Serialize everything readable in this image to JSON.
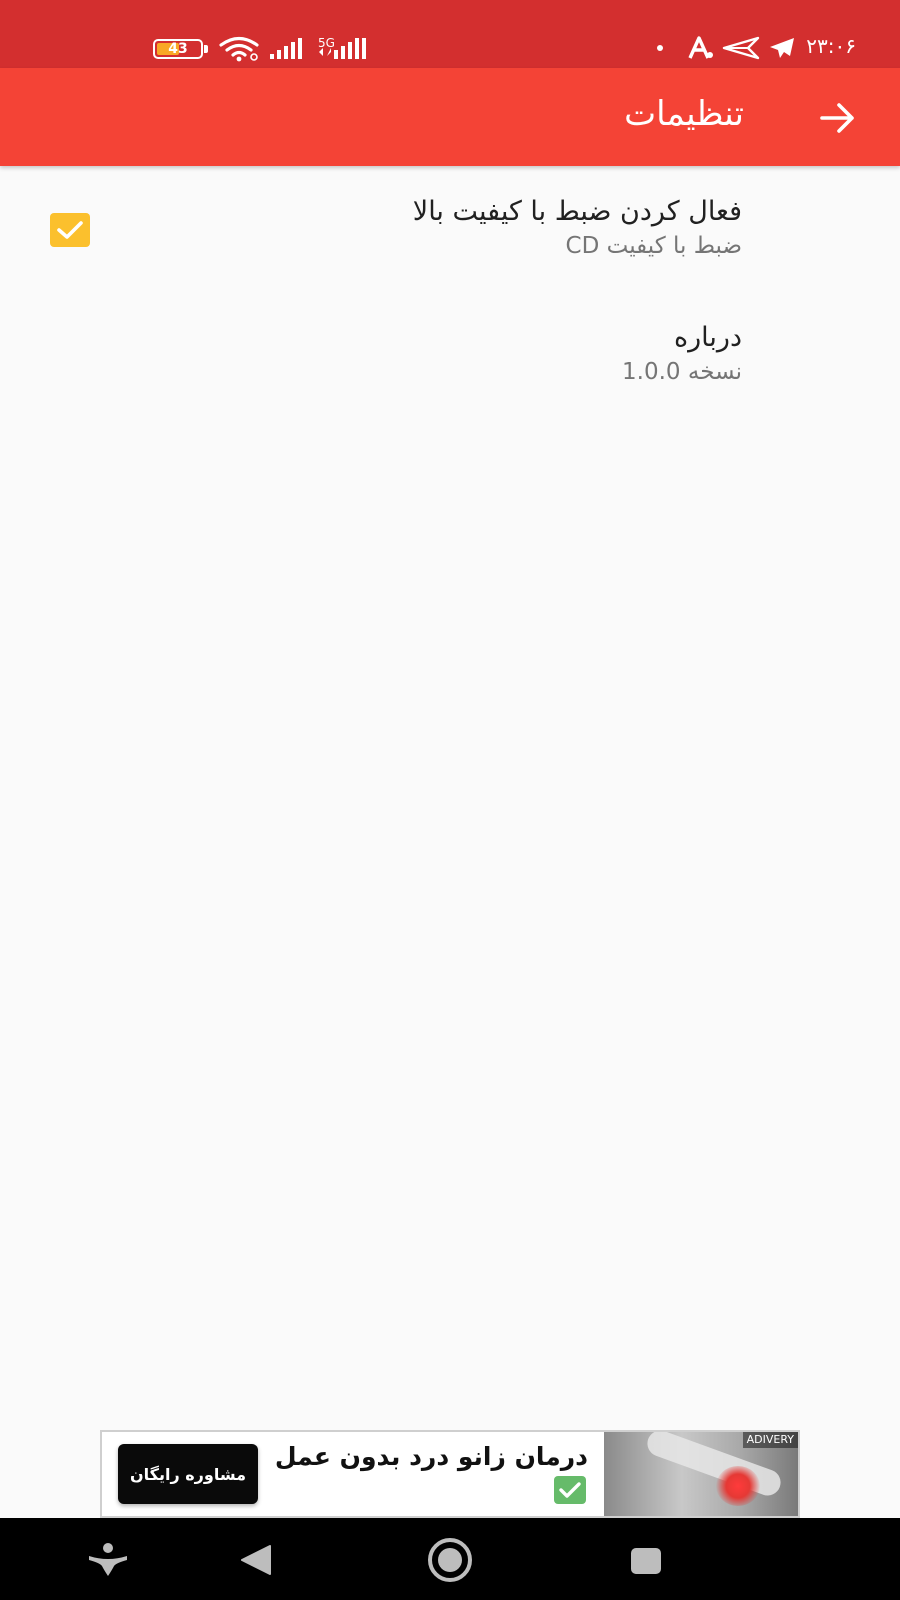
{
  "status_bar": {
    "time": "۲۳:۰۶",
    "battery_level": "43",
    "network_type": "5G",
    "icons": [
      "battery-icon",
      "wifi-icon",
      "signal-icon",
      "signal-5g-icon",
      "telegram-icon",
      "plane-send-icon",
      "app-notification-icon",
      "dot-icon"
    ]
  },
  "app_bar": {
    "title": "تنظیمات",
    "back_icon": "arrow-right-icon"
  },
  "preferences": [
    {
      "title": "فعال کردن ضبط با کیفیت بالا",
      "summary": "ضبط با کیفیت CD",
      "checked": true
    },
    {
      "title": "درباره",
      "summary": "نسخه 1.0.0"
    }
  ],
  "ad": {
    "badge": "ADIVERY",
    "headline": "درمان زانو درد بدون عمل",
    "cta": "مشاوره رایگان"
  },
  "nav_bar": {
    "icons": [
      "accessibility-icon",
      "back-triangle-icon",
      "home-circle-icon",
      "recents-square-icon"
    ]
  },
  "colors": {
    "status_bar": "#d32f2f",
    "app_bar": "#f44336",
    "checkbox": "#fbc02d",
    "background": "#fafafa"
  }
}
